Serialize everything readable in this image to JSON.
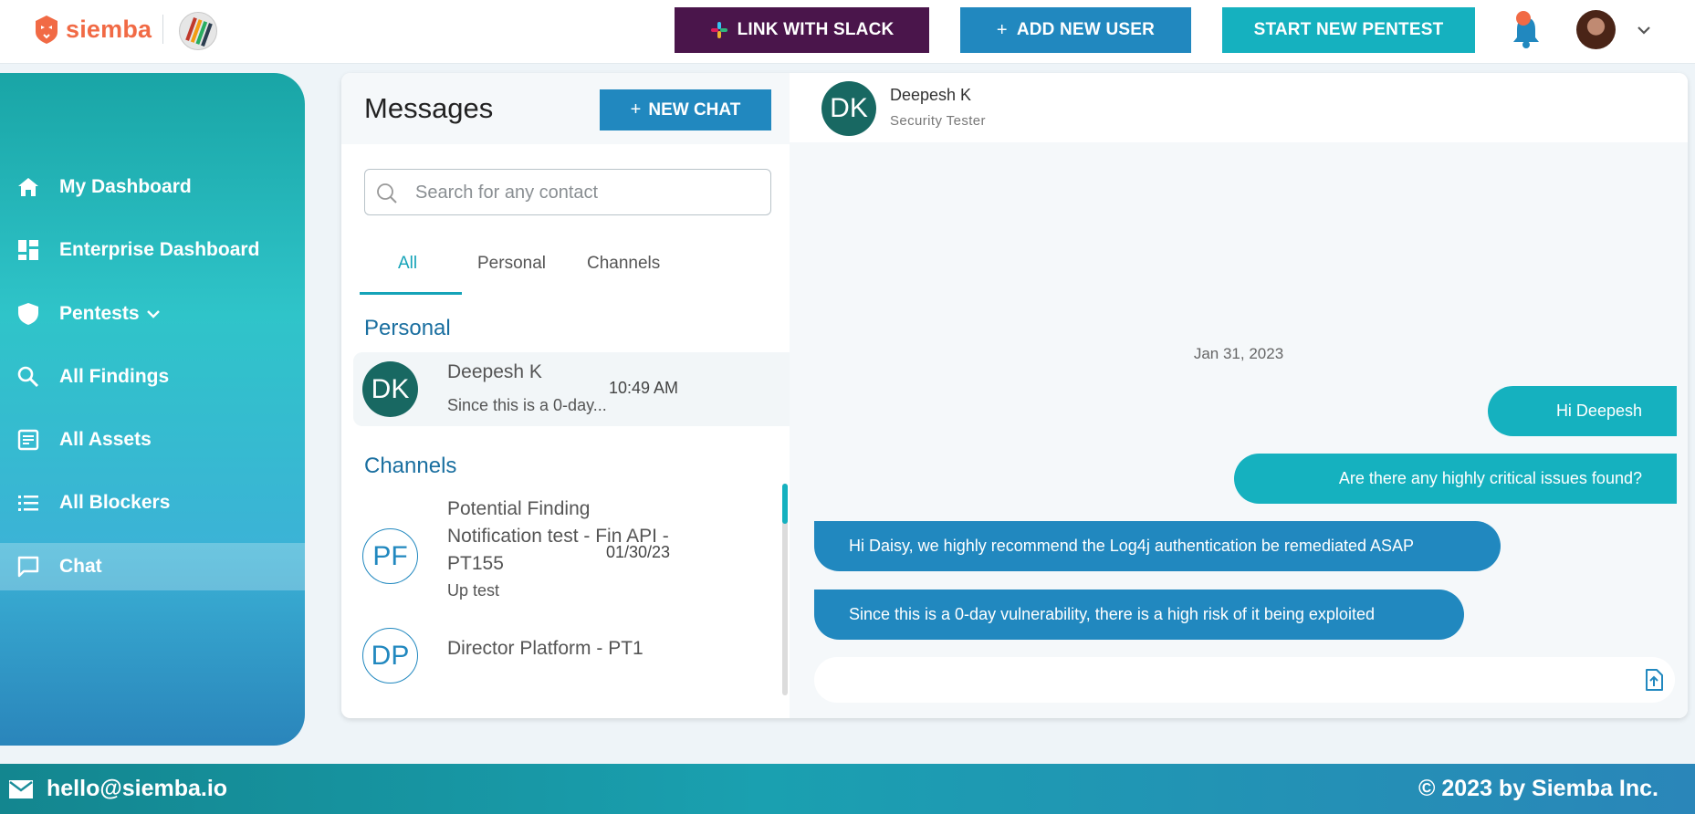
{
  "header": {
    "brand": "siemba",
    "slack_button": "LINK WITH SLACK",
    "add_user_button": "ADD NEW USER",
    "pentest_button": "START NEW PENTEST"
  },
  "sidebar": {
    "items": [
      {
        "label": "My Dashboard",
        "icon": "home-icon"
      },
      {
        "label": "Enterprise Dashboard",
        "icon": "dashboard-icon"
      },
      {
        "label": "Pentests",
        "icon": "shield-icon"
      },
      {
        "label": "All Findings",
        "icon": "search-icon"
      },
      {
        "label": "All Assets",
        "icon": "assets-icon"
      },
      {
        "label": "All Blockers",
        "icon": "list-icon"
      },
      {
        "label": "Chat",
        "icon": "chat-icon",
        "active": true
      }
    ]
  },
  "messages": {
    "title": "Messages",
    "new_chat_button": "NEW CHAT",
    "search_placeholder": "Search for any contact",
    "tabs": [
      "All",
      "Personal",
      "Channels"
    ],
    "active_tab": "All",
    "personal_section": "Personal",
    "channels_section": "Channels",
    "personal": [
      {
        "initials": "DK",
        "name": "Deepesh K",
        "preview": "Since this is a 0-day...",
        "time": "10:49 AM"
      }
    ],
    "channels": [
      {
        "initials": "PF",
        "name": "Potential Finding Notification test - Fin API - PT155",
        "preview": "Up test",
        "time": "01/30/23"
      },
      {
        "initials": "DP",
        "name": "Director Platform - PT1"
      }
    ]
  },
  "chat": {
    "contact_initials": "DK",
    "contact_name": "Deepesh K",
    "contact_role": "Security Tester",
    "date": "Jan 31, 2023",
    "messages": [
      {
        "direction": "out",
        "text": "Hi Deepesh"
      },
      {
        "direction": "out",
        "text": "Are there any highly critical issues found?"
      },
      {
        "direction": "in",
        "text": "Hi Daisy, we highly recommend the Log4j authentication be remediated ASAP"
      },
      {
        "direction": "in",
        "text": "Since this is a 0-day vulnerability, there is a high risk of it being exploited"
      }
    ]
  },
  "footer": {
    "email": "hello@siemba.io",
    "copyright": "© 2023 by Siemba Inc."
  },
  "colors": {
    "slack": "#4a154b",
    "primary_blue": "#2188bf",
    "teal": "#15b1bf",
    "brand_orange": "#f16a45",
    "avatar_green": "#186862"
  }
}
